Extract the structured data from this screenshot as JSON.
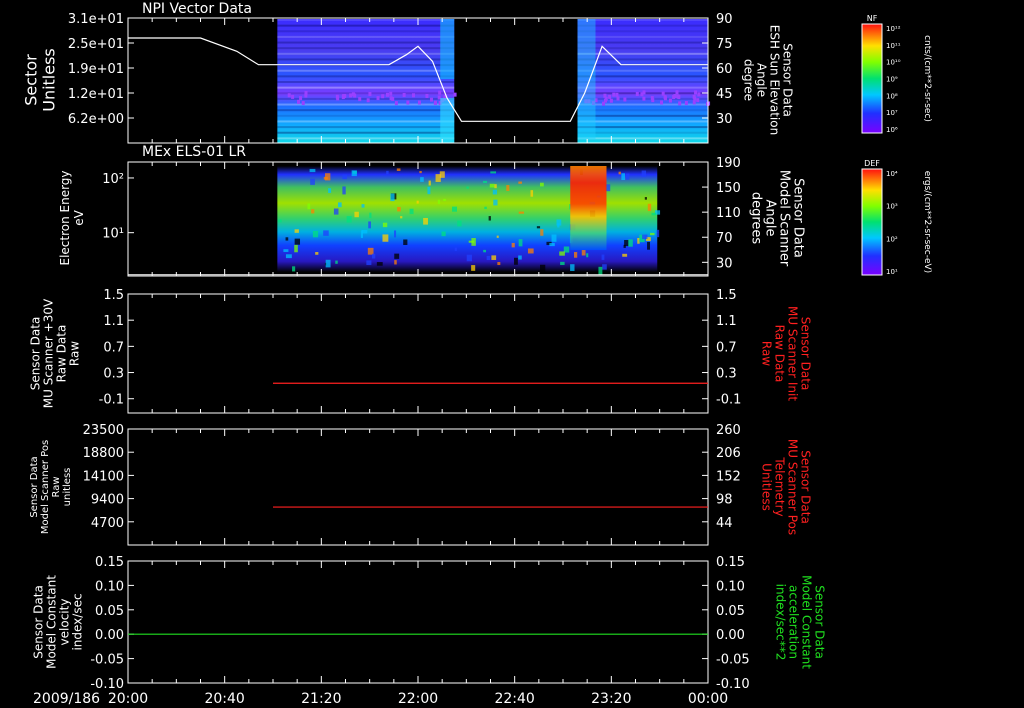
{
  "time_axis": {
    "date_label": "2009/186",
    "ticks": [
      "20:00",
      "20:40",
      "21:20",
      "22:00",
      "22:40",
      "23:20",
      "00:00"
    ],
    "range_hours": [
      20,
      24
    ]
  },
  "colorbars": [
    {
      "corner_label": "NF",
      "top_label": "10¹²",
      "tick_labels": [
        "10¹²",
        "10¹¹",
        "10¹⁰",
        "10⁹",
        "10⁸",
        "10⁷",
        "10⁶"
      ],
      "unit_label": "cnts/(cm**2-sr-sec)"
    },
    {
      "corner_label": "DEF",
      "top_label": "10⁴",
      "tick_labels": [
        "10⁴",
        "10³",
        "10²",
        "10¹"
      ],
      "unit_label": "ergs/(cm**2-sr-sec-eV)"
    }
  ],
  "colors": {
    "background": "#000000",
    "axis": "#ffffff",
    "red_series": "#ff2020",
    "green_series": "#20e020"
  },
  "chart_data": [
    {
      "type": "heatmap",
      "title": "NPI Vector Data",
      "ylabel_left": [
        "Sector",
        "Unitless"
      ],
      "yticks_left": [
        "3.1e+01",
        "2.5e+01",
        "1.9e+01",
        "1.2e+01",
        "6.2e+00"
      ],
      "ylabel_right": [
        "Sensor Data",
        "ESH Sun Elevation",
        "Angle",
        "degree"
      ],
      "yticks_right": [
        "90",
        "75",
        "60",
        "45",
        "30"
      ],
      "ylim_right": [
        15,
        90
      ],
      "data_spans_hours": [
        [
          21.03,
          22.25
        ],
        [
          23.1,
          24.0
        ]
      ],
      "overlay_line": {
        "name": "Sensor Data ESH Sun Elevation Angle",
        "x_hours": [
          20.0,
          20.5,
          20.75,
          20.9,
          21.5,
          21.8,
          21.92,
          22.0,
          22.1,
          22.2,
          22.3,
          23.05,
          23.15,
          23.27,
          23.4,
          23.6,
          24.0
        ],
        "y_deg": [
          78,
          78,
          70,
          62,
          62,
          62,
          68,
          73,
          64,
          42,
          28,
          28,
          45,
          73,
          62,
          62,
          62
        ]
      }
    },
    {
      "type": "heatmap",
      "title": "MEx ELS-01 LR",
      "ylabel_left": [
        "Electron Energy",
        "eV"
      ],
      "yticks_left": [
        "10²",
        "10¹"
      ],
      "ylabel_right": [
        "Sensor Data",
        "Model Scanner",
        "Angle",
        "degrees"
      ],
      "yticks_right": [
        "190",
        "150",
        "110",
        "70",
        "30"
      ],
      "ylim_right": [
        10,
        190
      ],
      "data_spans_hours": [
        [
          21.03,
          23.65
        ]
      ],
      "overlay_line": {
        "name": "Sensor Data Model Scanner Angle",
        "x_hours": [
          20.0,
          24.0
        ],
        "y_deg": [
          12,
          12
        ]
      }
    },
    {
      "type": "line",
      "ylabel_left": [
        "Sensor Data",
        "MU Scanner +30V",
        "Raw Data",
        "Raw"
      ],
      "yticks_left": [
        "1.5",
        "1.1",
        "0.7",
        "0.3",
        "-0.1"
      ],
      "ylim_left": [
        -0.5,
        1.5
      ],
      "ylabel_right": [
        "Sensor Data",
        "MU Scanner Init",
        "Raw Data",
        "Raw"
      ],
      "yticks_right": [
        "1.5",
        "1.1",
        "0.7",
        "0.3",
        "-0.1"
      ],
      "ylim_right": [
        -0.5,
        1.5
      ],
      "series": [
        {
          "name": "Sensor Data MU Scanner Init Raw Data",
          "x_hours": [
            21.0,
            24.0
          ],
          "values": [
            0.0,
            0.0
          ],
          "color": "#ff2020"
        }
      ]
    },
    {
      "type": "line",
      "ylabel_left": [
        "Sensor Data",
        "Model Scanner Pos",
        "Raw",
        "unitless"
      ],
      "yticks_left": [
        "23500",
        "18800",
        "14100",
        "9400",
        "4700"
      ],
      "ylabel_right": [
        "Sensor Data",
        "MU Scanner Pos",
        "Telemetry",
        "Unitless"
      ],
      "yticks_right": [
        "260",
        "206",
        "152",
        "98",
        "44"
      ],
      "ylim_right": [
        0,
        260
      ],
      "series": [
        {
          "name": "Sensor Data MU Scanner Pos Telemetry",
          "x_hours": [
            21.0,
            24.0
          ],
          "values": [
            85,
            85
          ],
          "color": "#ff2020"
        }
      ]
    },
    {
      "type": "line",
      "ylabel_left": [
        "Sensor Data",
        "Model Constant",
        "velocity",
        "index/sec"
      ],
      "yticks_left": [
        "0.15",
        "0.10",
        "0.05",
        "0.00",
        "-0.05",
        "-0.10"
      ],
      "ylim_left": [
        -0.1,
        0.15
      ],
      "ylabel_right": [
        "Sensor Data",
        "Model Constant",
        "acceleration",
        "index/sec**2"
      ],
      "yticks_right": [
        "0.15",
        "0.10",
        "0.05",
        "0.00",
        "-0.05",
        "-0.10"
      ],
      "ylim_right": [
        -0.1,
        0.15
      ],
      "series": [
        {
          "name": "Sensor Data Model Constant acceleration",
          "x_hours": [
            20.0,
            24.0
          ],
          "values": [
            0.0,
            0.0
          ],
          "color": "#20e020"
        }
      ]
    }
  ]
}
